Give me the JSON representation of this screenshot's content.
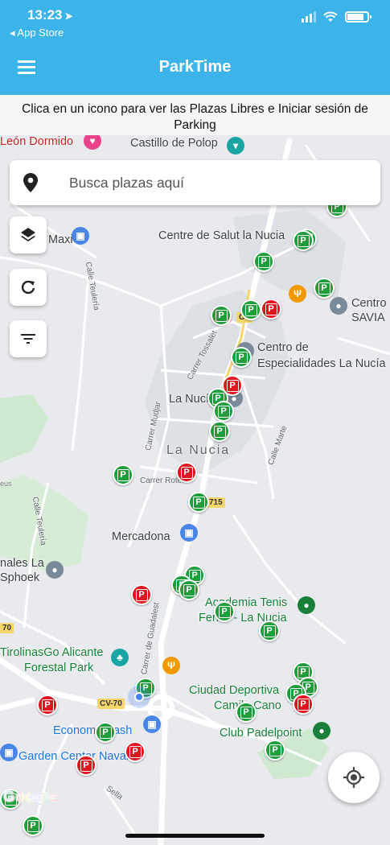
{
  "status": {
    "time": "13:23",
    "back_label": "◂ App Store"
  },
  "app": {
    "title": "ParkTime",
    "accent": "#3cb4ea"
  },
  "banner": {
    "text": "Clica en un icono para ver las Plazas Libres e Iniciar sesión de Parking"
  },
  "search": {
    "placeholder": "Busca plazas aquí"
  },
  "controls": {
    "layers": "layers-icon",
    "refresh": "refresh-icon",
    "filter": "filter-icon",
    "locate": "my-location-icon"
  },
  "map": {
    "labels": {
      "leon_dormido": "León Dormido",
      "castillo": "Castillo de Polop",
      "centre_salut": "Centre de Salut la Nucia",
      "maxi": "Maxi",
      "centro_savia_1": "Centro",
      "centro_savia_2": "SAVIA",
      "centro_esp_1": "Centro de",
      "centro_esp_2": "Especialidades La Nucía",
      "la_nucia_poi": "La Nucí",
      "la_nucia_town": "La Nucia",
      "mercadona": "Mercadona",
      "canales_1": "nales La",
      "canales_2": "Sphoek",
      "academia_1": "Academia Tenis",
      "academia_2": "Ferrer - La Nucia",
      "tirolinas_1": "TirolinasGo Alicante",
      "tirolinas_2": "Forestal Park",
      "ciudad_dep_1": "Ciudad Deportiva",
      "ciudad_dep_2": "Camilo Cano",
      "club_padel": "Club Padelpoint",
      "economy": "Economy Cash",
      "garden": "Garden Center Navarro",
      "calle_teulera": "Calle Teulería",
      "carrer_tossalet": "Carrer Tossalet",
      "carrer_mudjar": "Carrer Mudjar",
      "carrer_rotes": "Carrer Rotes",
      "calle_marte": "Calle Marte",
      "carrer_guadalest": "Carrer de Guadalest",
      "sella": "Sella",
      "road_cv70": "CV-70",
      "road_715": "715",
      "road_cv": "CV",
      "road_e": "eus",
      "road_70": "70",
      "google": "Google"
    }
  }
}
